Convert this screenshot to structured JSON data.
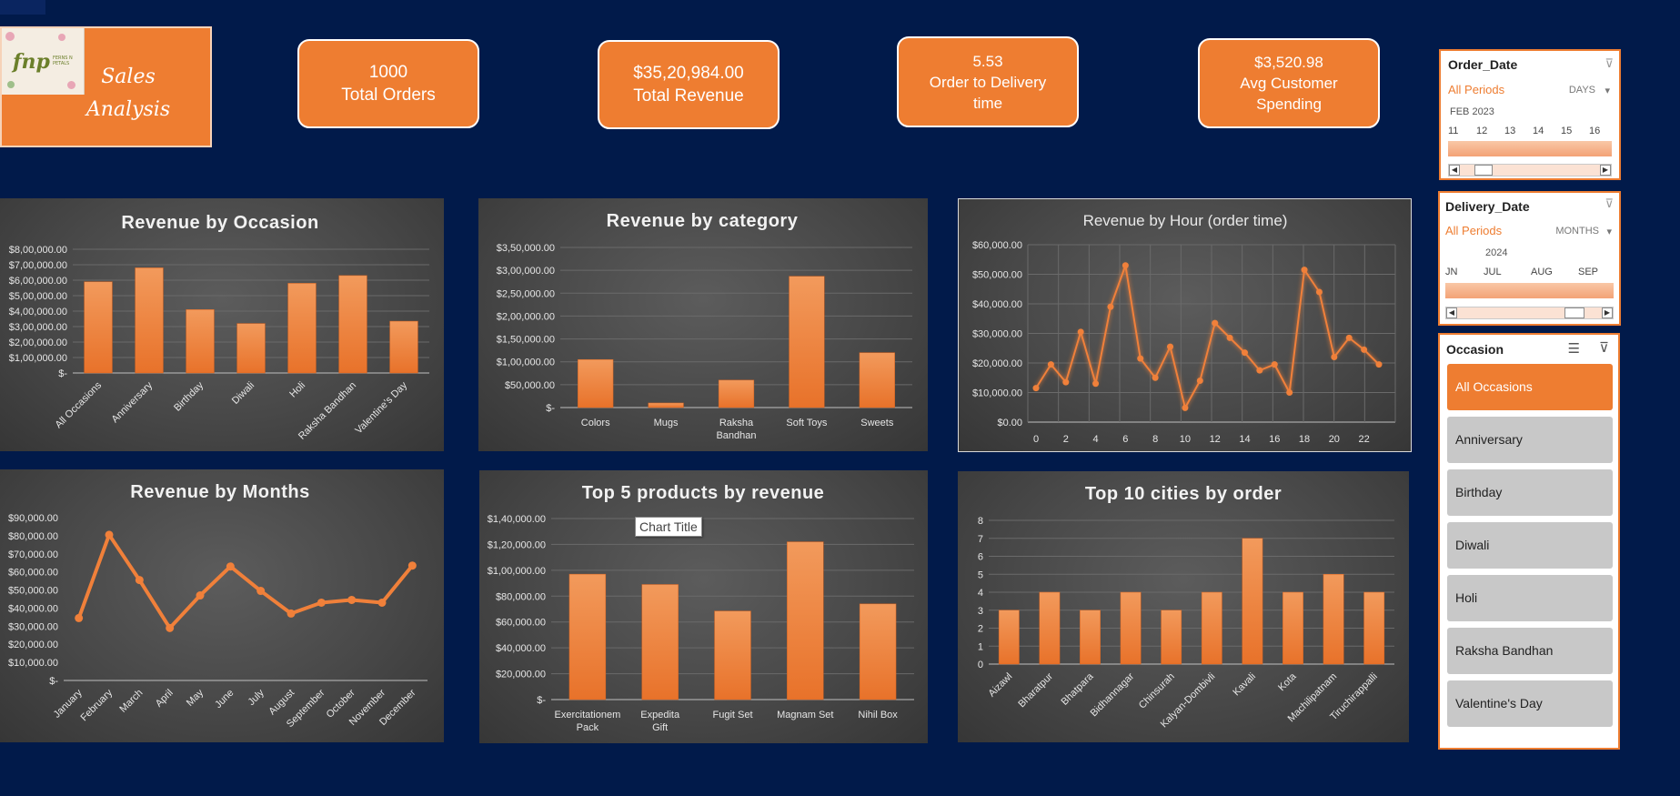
{
  "header": {
    "logo_text": "fnp",
    "logo_subtext": "FERNS N PETALS",
    "title": "Sales Analysis"
  },
  "kpis": [
    {
      "value": "1000",
      "label": "Total Orders"
    },
    {
      "value": "$35,20,984.00",
      "label": "Total Revenue"
    },
    {
      "value": "5.53",
      "label": "Order to Delivery time"
    },
    {
      "value": "$3,520.98",
      "label": "Avg Customer Spending"
    }
  ],
  "slicers": {
    "order_date": {
      "title": "Order_Date",
      "all_label": "All Periods",
      "unit": "DAYS",
      "period": "FEB 2023",
      "ticks": [
        "11",
        "12",
        "13",
        "14",
        "15",
        "16"
      ]
    },
    "delivery_date": {
      "title": "Delivery_Date",
      "all_label": "All Periods",
      "unit": "MONTHS",
      "period": "2024",
      "ticks": [
        "JN",
        "JUL",
        "AUG",
        "SEP"
      ]
    },
    "occasion": {
      "title": "Occasion",
      "items": [
        "All Occasions",
        "Anniversary",
        "Birthday",
        "Diwali",
        "Holi",
        "Raksha Bandhan",
        "Valentine's Day"
      ],
      "selected": "All Occasions"
    }
  },
  "colors": {
    "background": "#011a4a",
    "accent": "#ee7d31",
    "panel": "#484848"
  },
  "tooltip": "Chart Title",
  "chart_data": [
    {
      "id": "occasion",
      "type": "bar",
      "title": "Revenue by Occasion",
      "categories": [
        "All Occasions",
        "Anniversary",
        "Birthday",
        "Diwali",
        "Holi",
        "Raksha Bandhan",
        "Valentine's Day"
      ],
      "values": [
        590000,
        680000,
        410000,
        320000,
        580000,
        630000,
        335000
      ],
      "ylim": [
        0,
        800000
      ],
      "yticks": [
        0,
        100000,
        200000,
        300000,
        400000,
        500000,
        600000,
        700000,
        800000
      ],
      "ytick_labels": [
        "$-",
        "$1,00,000.00",
        "$2,00,000.00",
        "$3,00,000.00",
        "$4,00,000.00",
        "$5,00,000.00",
        "$6,00,000.00",
        "$7,00,000.00",
        "$8,00,000.00"
      ],
      "grid": true
    },
    {
      "id": "category",
      "type": "bar",
      "title": "Revenue by category",
      "categories": [
        "Colors",
        "Mugs",
        "Raksha Bandhan",
        "Soft Toys",
        "Sweets"
      ],
      "values": [
        105000,
        10000,
        60000,
        287000,
        120000
      ],
      "ylim": [
        0,
        350000
      ],
      "yticks": [
        0,
        50000,
        100000,
        150000,
        200000,
        250000,
        300000,
        350000
      ],
      "ytick_labels": [
        "$-",
        "$50,000.00",
        "$1,00,000.00",
        "$1,50,000.00",
        "$2,00,000.00",
        "$2,50,000.00",
        "$3,00,000.00",
        "$3,50,000.00"
      ],
      "grid": true
    },
    {
      "id": "hour",
      "type": "line",
      "title": "Revenue by Hour (order time)",
      "x": [
        0,
        1,
        2,
        3,
        4,
        5,
        6,
        7,
        8,
        9,
        10,
        11,
        12,
        13,
        14,
        15,
        16,
        17,
        18,
        19,
        20,
        21,
        22,
        23
      ],
      "values": [
        11500,
        19500,
        13500,
        30500,
        13000,
        39000,
        53000,
        21500,
        15000,
        25500,
        4800,
        14000,
        33500,
        28500,
        23500,
        17500,
        19500,
        10000,
        51500,
        44000,
        22000,
        28500,
        24500,
        19500
      ],
      "ylim": [
        0,
        60000
      ],
      "yticks": [
        0,
        10000,
        20000,
        30000,
        40000,
        50000,
        60000
      ],
      "ytick_labels": [
        "$0.00",
        "$10,000.00",
        "$20,000.00",
        "$30,000.00",
        "$40,000.00",
        "$50,000.00",
        "$60,000.00"
      ],
      "xtick_labels": [
        "0",
        "2",
        "4",
        "6",
        "8",
        "10",
        "12",
        "14",
        "16",
        "18",
        "20",
        "22"
      ],
      "grid": true
    },
    {
      "id": "months",
      "type": "line",
      "title": "Revenue by Months",
      "categories": [
        "January",
        "February",
        "March",
        "April",
        "May",
        "June",
        "July",
        "August",
        "September",
        "October",
        "November",
        "December"
      ],
      "values": [
        34500,
        80500,
        55500,
        29000,
        47000,
        63000,
        49500,
        37000,
        43000,
        44500,
        43000,
        63500
      ],
      "ylim": [
        0,
        90000
      ],
      "yticks": [
        0,
        10000,
        20000,
        30000,
        40000,
        50000,
        60000,
        70000,
        80000,
        90000
      ],
      "ytick_labels": [
        "$-",
        "$10,000.00",
        "$20,000.00",
        "$30,000.00",
        "$40,000.00",
        "$50,000.00",
        "$60,000.00",
        "$70,000.00",
        "$80,000.00",
        "$90,000.00"
      ],
      "grid": false
    },
    {
      "id": "products",
      "type": "bar",
      "title": "Top 5 products by revenue",
      "categories": [
        "Exercitationem Pack",
        "Expedita Gift",
        "Fugit Set",
        "Magnam Set",
        "Nihil Box"
      ],
      "values": [
        97000,
        89000,
        68500,
        122000,
        74000
      ],
      "ylim": [
        0,
        140000
      ],
      "yticks": [
        0,
        20000,
        40000,
        60000,
        80000,
        100000,
        120000,
        140000
      ],
      "ytick_labels": [
        "$-",
        "$20,000.00",
        "$40,000.00",
        "$60,000.00",
        "$80,000.00",
        "$1,00,000.00",
        "$1,20,000.00",
        "$1,40,000.00"
      ],
      "grid": true
    },
    {
      "id": "cities",
      "type": "bar",
      "title": "Top 10 cities by order",
      "categories": [
        "Aizawl",
        "Bharatpur",
        "Bhatpara",
        "Bidhannagar",
        "Chinsurah",
        "Kalyan-Dombivli",
        "Kavali",
        "Kota",
        "Machilipatnam",
        "Tiruchirappalli"
      ],
      "values": [
        3,
        4,
        3,
        4,
        3,
        4,
        7,
        4,
        5,
        4
      ],
      "ylim": [
        0,
        8
      ],
      "yticks": [
        0,
        1,
        2,
        3,
        4,
        5,
        6,
        7,
        8
      ],
      "ytick_labels": [
        "0",
        "1",
        "2",
        "3",
        "4",
        "5",
        "6",
        "7",
        "8"
      ],
      "grid": true
    }
  ]
}
